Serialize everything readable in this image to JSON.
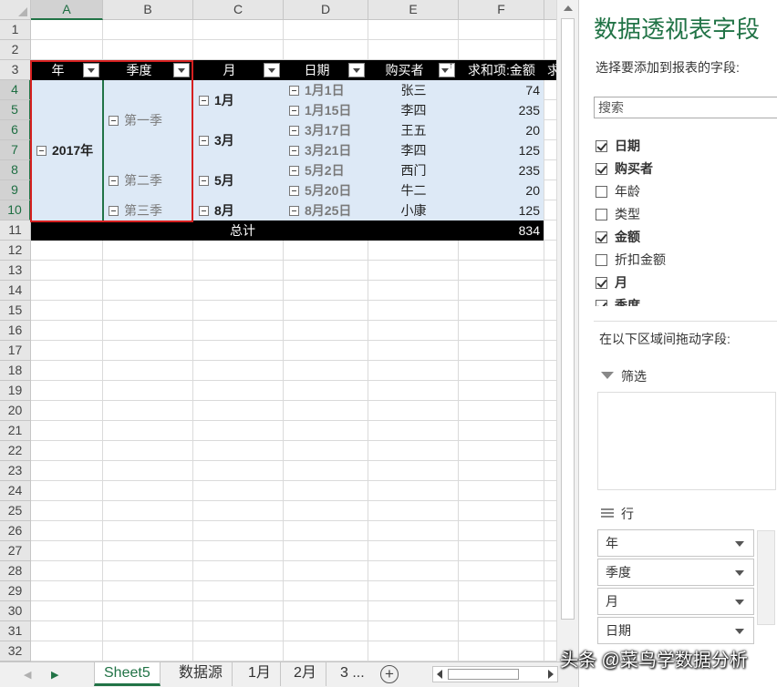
{
  "columns": [
    "A",
    "B",
    "C",
    "D",
    "E",
    "F"
  ],
  "rows": [
    "1",
    "2",
    "3",
    "4",
    "5",
    "6",
    "7",
    "8",
    "9",
    "10",
    "11",
    "12",
    "13",
    "14",
    "15",
    "16",
    "17",
    "18",
    "19",
    "20",
    "21",
    "22",
    "23",
    "24",
    "25",
    "26",
    "27",
    "28",
    "29",
    "30",
    "31",
    "32"
  ],
  "pivot": {
    "headers": [
      "年",
      "季度",
      "月",
      "日期",
      "购买者",
      "求和项:金额",
      "求"
    ],
    "year": "2017年",
    "quarters": [
      "第一季",
      "第二季",
      "第三季"
    ],
    "months": [
      "1月",
      "3月",
      "5月",
      "8月"
    ],
    "records": [
      {
        "date": "1月1日",
        "buyer": "张三",
        "amount": "74"
      },
      {
        "date": "1月15日",
        "buyer": "李四",
        "amount": "235"
      },
      {
        "date": "3月17日",
        "buyer": "王五",
        "amount": "20"
      },
      {
        "date": "3月21日",
        "buyer": "李四",
        "amount": "125"
      },
      {
        "date": "5月2日",
        "buyer": "西门",
        "amount": "235"
      },
      {
        "date": "5月20日",
        "buyer": "牛二",
        "amount": "20"
      },
      {
        "date": "8月25日",
        "buyer": "小康",
        "amount": "125"
      }
    ],
    "total_label": "总计",
    "total_value": "834"
  },
  "tabs": {
    "items": [
      "Sheet5",
      "数据源",
      "1月",
      "2月",
      "3 ..."
    ],
    "add_label": "+"
  },
  "pane": {
    "title": "数据透视表字段",
    "subtitle": "选择要添加到报表的字段:",
    "search_placeholder": "搜索",
    "fields": [
      {
        "name": "日期",
        "checked": true
      },
      {
        "name": "购买者",
        "checked": true
      },
      {
        "name": "年龄",
        "checked": false
      },
      {
        "name": "类型",
        "checked": false
      },
      {
        "name": "金额",
        "checked": true
      },
      {
        "name": "折扣金额",
        "checked": false
      },
      {
        "name": "月",
        "checked": true
      },
      {
        "name": "季度",
        "checked": true
      }
    ],
    "drag_label": "在以下区域间拖动字段:",
    "filter_label": "筛选",
    "rows_label": "行",
    "row_fields": [
      "年",
      "季度",
      "月",
      "日期"
    ]
  },
  "watermark": "头条 @菜鸟学数据分析",
  "colors": {
    "accent": "#217346",
    "highlight": "#d62020",
    "pivot_fill": "#dde9f6"
  }
}
